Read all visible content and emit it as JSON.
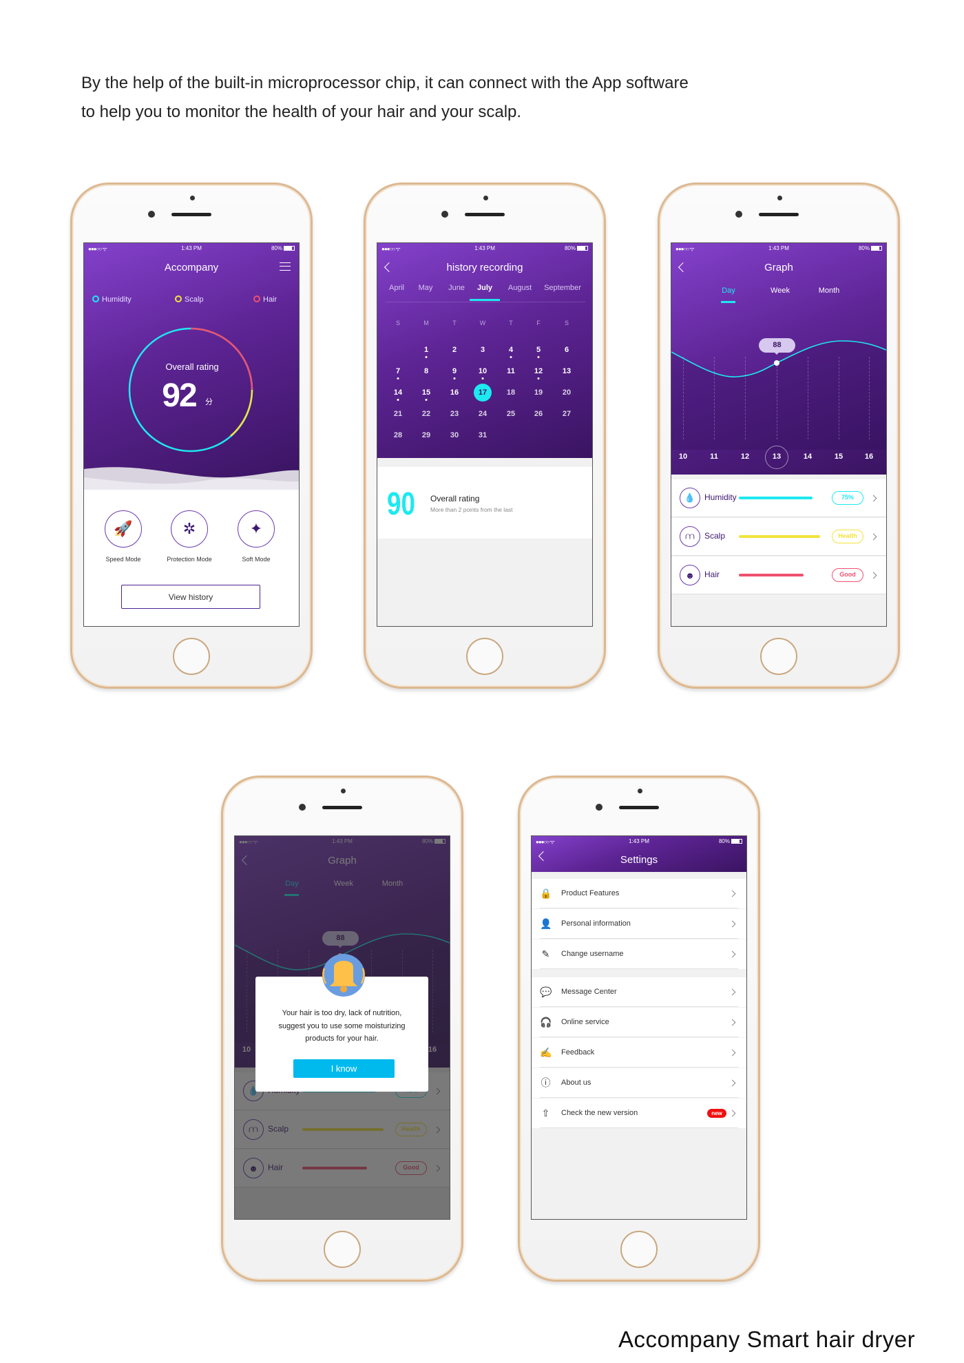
{
  "intro": {
    "line1": "By the help of the built-in microprocessor chip, it can connect with the App software",
    "line2": "to help you to monitor the health of your hair and your scalp."
  },
  "footer_title": "Accompany Smart hair dryer",
  "status_bar": {
    "signal": "●●●○○ ᯤ",
    "time": "1:43 PM",
    "battery": "80%"
  },
  "colors": {
    "purple_top": "#8441cc",
    "purple_bottom": "#3a1462",
    "cyan": "#1de9f0",
    "yellow": "#f2e33c",
    "pink": "#f0506e",
    "button_blue": "#00baee",
    "badge_red": "#ee1111"
  },
  "home": {
    "title": "Accompany",
    "menu_icon": "hamburger-menu-icon",
    "legend": [
      {
        "label": "Humidity",
        "color": "#1de9f0"
      },
      {
        "label": "Scalp",
        "color": "#f2e33c"
      },
      {
        "label": "Hair",
        "color": "#f0506e"
      }
    ],
    "overall_label": "Overall rating",
    "score": "92",
    "score_unit": "分",
    "modes": [
      {
        "label": "Speed Mode",
        "icon": "rocket-icon"
      },
      {
        "label": "Protection Mode",
        "icon": "molecule-icon"
      },
      {
        "label": "Soft Mode",
        "icon": "magic-wand-icon"
      }
    ],
    "view_history": "View history"
  },
  "history": {
    "title": "history recording",
    "months": [
      "April",
      "May",
      "June",
      "July",
      "August",
      "September"
    ],
    "active_month": 3,
    "weekdays": [
      "S",
      "M",
      "T",
      "W",
      "T",
      "F",
      "S"
    ],
    "first_weekday": 1,
    "days_in_month": 31,
    "selected_day": 17,
    "days_with_records": [
      1,
      4,
      5,
      7,
      9,
      10,
      12,
      14,
      15
    ],
    "rating": "90",
    "rating_label": "Overall rating",
    "rating_note": "More than 2 points from the last"
  },
  "graph": {
    "title": "Graph",
    "tabs": [
      "Day",
      "Week",
      "Month"
    ],
    "active_tab": 0,
    "days": [
      "10",
      "11",
      "12",
      "13",
      "14",
      "15",
      "16"
    ],
    "selected_day_index": 3,
    "selected_value": "88",
    "metrics": [
      {
        "label": "Humidity",
        "badge": "75%",
        "color": "#1de9f0",
        "level": 0.82,
        "icon": "water-drops-icon",
        "glyph": "💧"
      },
      {
        "label": "Scalp",
        "badge": "Health",
        "color": "#f2e33c",
        "level": 0.91,
        "icon": "scalp-icon",
        "glyph": "⩋"
      },
      {
        "label": "Hair",
        "badge": "Good",
        "color": "#f0506e",
        "level": 0.72,
        "icon": "hair-head-icon",
        "glyph": "☻"
      }
    ]
  },
  "alert": {
    "message_lines": [
      "Your hair is too dry, lack of nutrition,",
      "suggest you to use some moisturizing",
      "products for your hair."
    ],
    "button": "I know",
    "icon": "bell-icon"
  },
  "settings": {
    "title": "Settings",
    "new_badge": "new",
    "groups": [
      [
        {
          "label": "Product Features",
          "icon": "lock-icon",
          "glyph": "🔒"
        },
        {
          "label": "Personal information",
          "icon": "user-icon",
          "glyph": "👤"
        },
        {
          "label": "Change username",
          "icon": "edit-box-icon",
          "glyph": "✎"
        }
      ],
      [
        {
          "label": "Message Center",
          "icon": "chat-bubble-icon",
          "glyph": "💬"
        },
        {
          "label": "Online service",
          "icon": "headset-icon",
          "glyph": "🎧"
        },
        {
          "label": "Feedback",
          "icon": "feedback-edit-icon",
          "glyph": "✍"
        },
        {
          "label": "About us",
          "icon": "info-icon",
          "glyph": "ⓘ"
        },
        {
          "label": "Check the new version",
          "icon": "upload-arrow-icon",
          "glyph": "⇧",
          "badge": true
        }
      ]
    ]
  }
}
